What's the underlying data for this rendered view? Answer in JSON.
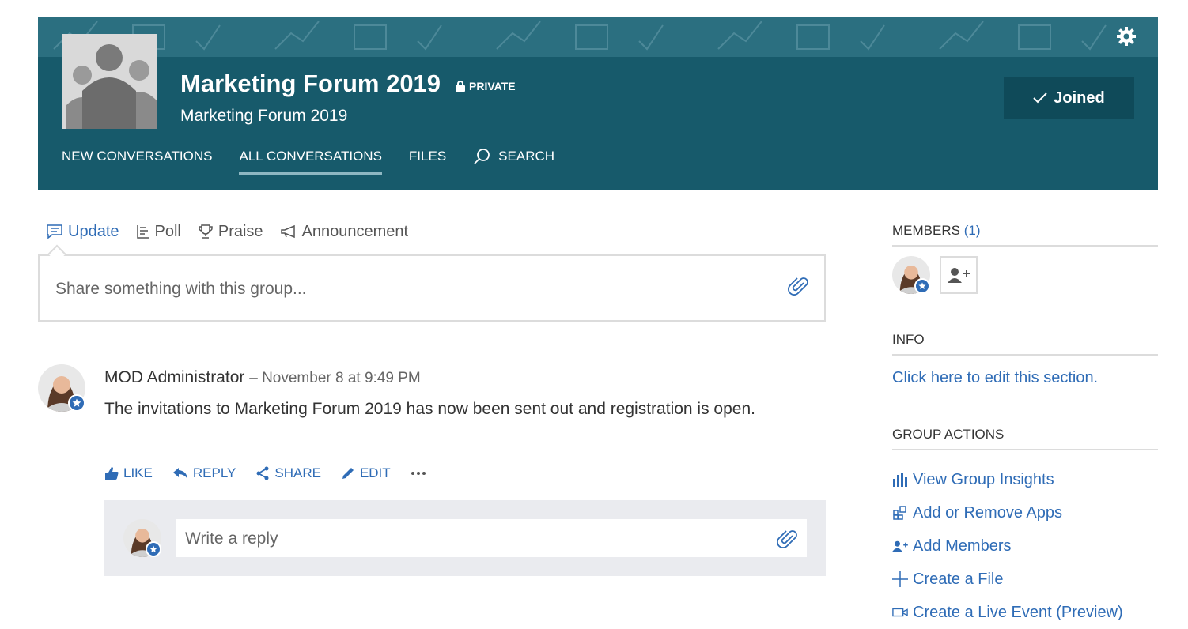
{
  "header": {
    "title": "Marketing Forum 2019",
    "privacy": "PRIVATE",
    "subtitle": "Marketing Forum 2019",
    "joined_label": "Joined",
    "nav": [
      "NEW CONVERSATIONS",
      "ALL CONVERSATIONS",
      "FILES",
      "SEARCH"
    ],
    "colors": {
      "bg": "#175a6b",
      "pattern": "#2b6f80",
      "joined_bg": "#0f4a59"
    }
  },
  "composer": {
    "tabs": [
      "Update",
      "Poll",
      "Praise",
      "Announcement"
    ],
    "placeholder": "Share something with this group..."
  },
  "post": {
    "author": "MOD Administrator",
    "meta": "– November 8 at 9:49 PM",
    "body": "The invitations to Marketing Forum 2019 has now been sent out and registration is open.",
    "actions": [
      "LIKE",
      "REPLY",
      "SHARE",
      "EDIT"
    ],
    "reply_placeholder": "Write a reply"
  },
  "rail": {
    "members_heading": "MEMBERS",
    "members_count": "(1)",
    "info_heading": "INFO",
    "info_link": "Click here to edit this section.",
    "group_actions_heading": "GROUP ACTIONS",
    "group_actions": [
      {
        "label": "View Group Insights",
        "icon": "bar-chart-icon"
      },
      {
        "label": "Add or Remove Apps",
        "icon": "apps-icon"
      },
      {
        "label": "Add Members",
        "icon": "add-person-icon"
      },
      {
        "label": "Create a File",
        "icon": "plus-icon"
      },
      {
        "label": "Create a Live Event (Preview)",
        "icon": "video-icon"
      }
    ]
  },
  "accent": "#2f6cb6"
}
